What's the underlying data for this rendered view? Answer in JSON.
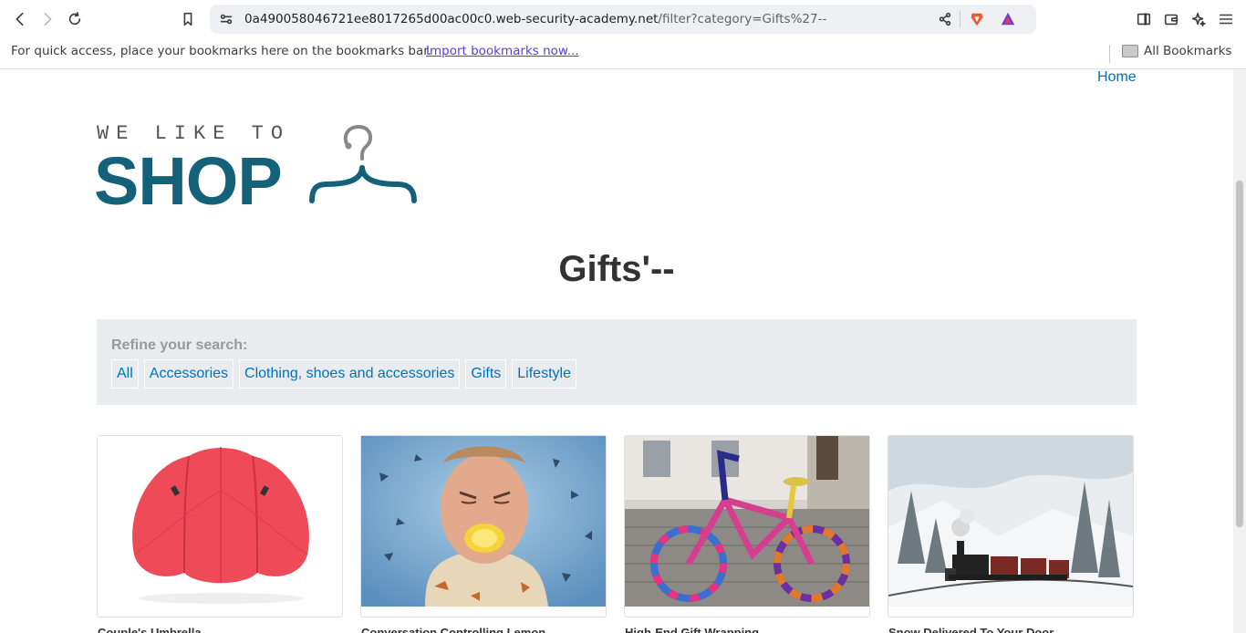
{
  "browser": {
    "url_host": "0a490058046721ee8017265d00ac00c0.web-security-academy.net",
    "url_path": "/filter?category=Gifts%27--",
    "bookmarks_prompt": "For quick access, place your bookmarks here on the bookmarks bar.",
    "import_link": "Import bookmarks now...",
    "all_bookmarks": "All Bookmarks"
  },
  "nav": {
    "home": "Home"
  },
  "logo": {
    "top": "WE LIKE TO",
    "main": "SHOP"
  },
  "page": {
    "title": "Gifts'--"
  },
  "filter": {
    "label": "Refine your search:",
    "items": [
      "All",
      "Accessories",
      "Clothing, shoes and accessories",
      "Gifts",
      "Lifestyle"
    ]
  },
  "products": [
    {
      "name": "Couple's Umbrella",
      "image": "red-umbrella"
    },
    {
      "name": "Conversation Controlling Lemon",
      "image": "man-biting-lemon"
    },
    {
      "name": "High-End Gift Wrapping",
      "image": "knitted-bicycle"
    },
    {
      "name": "Snow Delivered To Your Door",
      "image": "snowy-train"
    }
  ],
  "colors": {
    "brand": "#14617a",
    "link": "#0071bc",
    "filter_bg": "#e8ecee"
  }
}
